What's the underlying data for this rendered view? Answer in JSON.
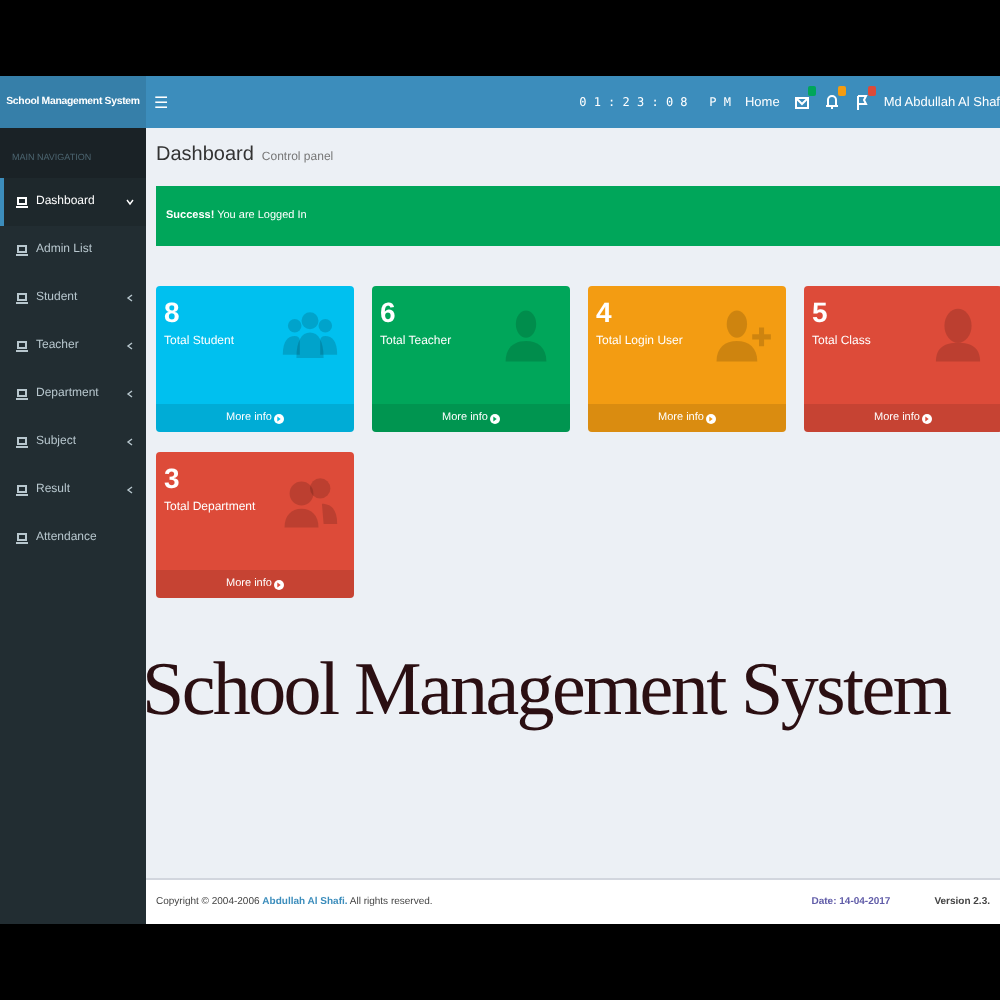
{
  "header": {
    "logo": "School Management System",
    "menu_glyph": "☰",
    "clock": "0 1 : 2 3 : 0 8   P M",
    "home": "Home",
    "user": "Md Abdullah Al Shaf",
    "badges": [
      {
        "color": "#00a65a"
      },
      {
        "color": "#f39c12"
      },
      {
        "color": "#dd4b39"
      }
    ]
  },
  "sidebar": {
    "heading": "MAIN NAVIGATION",
    "items": [
      {
        "label": "Dashboard",
        "selected": true,
        "expanded": true
      },
      {
        "label": "Admin List",
        "selected": false
      },
      {
        "label": "Student",
        "selected": false,
        "expanded": false
      },
      {
        "label": "Teacher",
        "selected": false,
        "expanded": false
      },
      {
        "label": "Department",
        "selected": false,
        "expanded": false
      },
      {
        "label": "Subject",
        "selected": false,
        "expanded": false
      },
      {
        "label": "Result",
        "selected": false,
        "expanded": false
      },
      {
        "label": "Attendance",
        "selected": false
      }
    ]
  },
  "page": {
    "title": "Dashboard",
    "subtitle": "Control panel",
    "alert": "**Success!** You are Logged In"
  },
  "cards": [
    {
      "count": "8",
      "label": "Total Student",
      "link": "More info",
      "color": "#00c0ef"
    },
    {
      "count": "6",
      "label": "Total Teacher",
      "link": "More info",
      "color": "#00a65a"
    },
    {
      "count": "4",
      "label": "Total Login User",
      "link": "More info",
      "color": "#f39c12"
    },
    {
      "count": "5",
      "label": "Total Class",
      "link": "More info",
      "color": "#dd4b39"
    },
    {
      "count": "3",
      "label": "Total Department",
      "link": "More info",
      "color": "#dd4b39"
    }
  ],
  "overlay_title": "School Management System",
  "footer": {
    "copyright": "Copyright © 2004-2006 **Abdullah Al Shafi.** All rights reserved.",
    "date": "Date: 14-04-2017",
    "version": "Version 2.3."
  }
}
